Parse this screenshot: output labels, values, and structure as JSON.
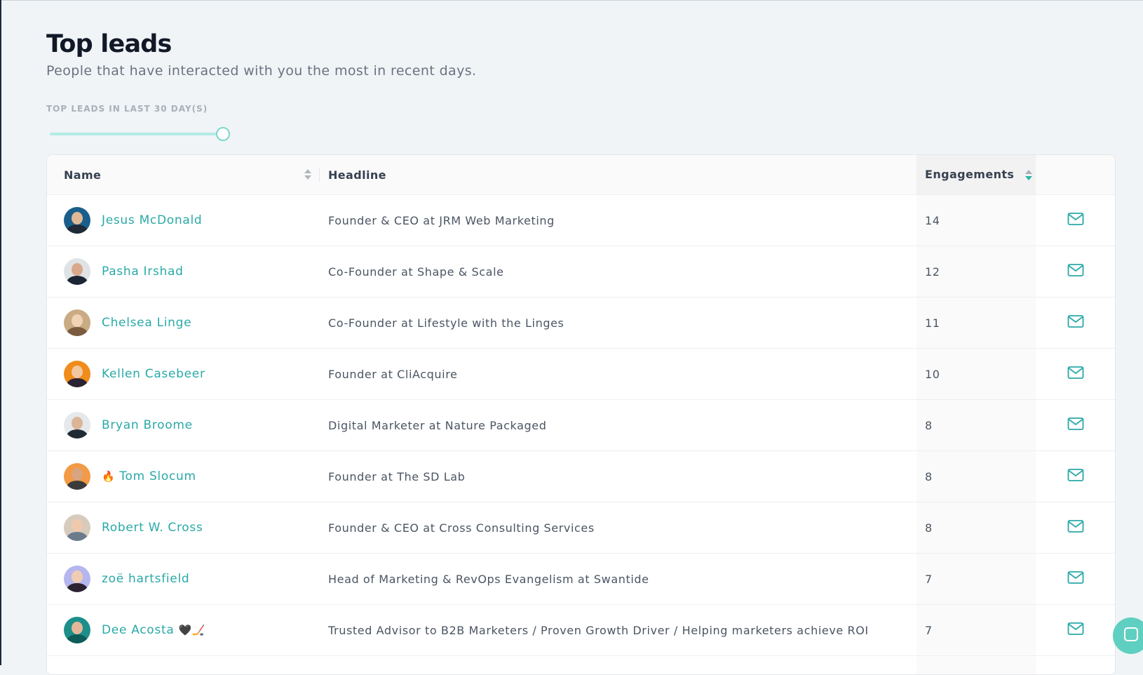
{
  "header": {
    "title": "Top leads",
    "subtitle": "People that have interacted with you the most in recent days."
  },
  "filter": {
    "label": "TOP LEADS IN LAST 30 DAY(S)",
    "slider_fraction": 1.0
  },
  "table": {
    "columns": {
      "name": "Name",
      "headline": "Headline",
      "engagements": "Engagements"
    },
    "rows": [
      {
        "prefix": "",
        "name": "Jesus McDonald",
        "suffix": "",
        "headline": "Founder & CEO at JRM Web Marketing",
        "engagements": "14",
        "avatar_bg": "#1a5f8c",
        "avatar_skin": "#e0b896",
        "avatar_shirt": "#1f2937"
      },
      {
        "prefix": "",
        "name": "Pasha Irshad",
        "suffix": "",
        "headline": "Co-Founder at Shape & Scale",
        "engagements": "12",
        "avatar_bg": "#dfe3e6",
        "avatar_skin": "#d9a98a",
        "avatar_shirt": "#1c2533"
      },
      {
        "prefix": "",
        "name": "Chelsea Linge",
        "suffix": "",
        "headline": "Co-Founder at Lifestyle with the Linges",
        "engagements": "11",
        "avatar_bg": "#c9ab84",
        "avatar_skin": "#f0d2b4",
        "avatar_shirt": "#7a5b3d"
      },
      {
        "prefix": "",
        "name": "Kellen Casebeer",
        "suffix": "",
        "headline": "Founder at CliAcquire",
        "engagements": "10",
        "avatar_bg": "#f08c1a",
        "avatar_skin": "#f3c7a0",
        "avatar_shirt": "#2b2233"
      },
      {
        "prefix": "",
        "name": "Bryan Broome",
        "suffix": "",
        "headline": "Digital Marketer at Nature Packaged",
        "engagements": "8",
        "avatar_bg": "#e5e9ec",
        "avatar_skin": "#dcb596",
        "avatar_shirt": "#202a33"
      },
      {
        "prefix": "🔥",
        "name": "Tom Slocum",
        "suffix": "",
        "headline": "Founder at The SD Lab",
        "engagements": "8",
        "avatar_bg": "#f29a45",
        "avatar_skin": "#d9a480",
        "avatar_shirt": "#3b3b3b"
      },
      {
        "prefix": "",
        "name": "Robert W. Cross",
        "suffix": "",
        "headline": "Founder & CEO at Cross Consulting Services",
        "engagements": "8",
        "avatar_bg": "#d7cbbd",
        "avatar_skin": "#f0c9ad",
        "avatar_shirt": "#6b7b8c"
      },
      {
        "prefix": "",
        "name": "zoë hartsfield",
        "suffix": "",
        "headline": "Head of Marketing & RevOps Evangelism at Swantide",
        "engagements": "7",
        "avatar_bg": "#b5b6ef",
        "avatar_skin": "#f0cdb2",
        "avatar_shirt": "#2a2230"
      },
      {
        "prefix": "",
        "name": "Dee Acosta",
        "suffix": "🖤🏒",
        "headline": "Trusted Advisor to B2B Marketers / Proven Growth Driver / Helping marketers achieve ROI",
        "engagements": "7",
        "avatar_bg": "#1d8f8a",
        "avatar_skin": "#e3b89a",
        "avatar_shirt": "#0d5c59"
      },
      {
        "prefix": "",
        "name": "",
        "suffix": "",
        "headline": "",
        "engagements": "",
        "avatar_bg": "#cccccc",
        "avatar_skin": "#cccccc",
        "avatar_shirt": "#cccccc"
      }
    ]
  },
  "colors": {
    "accent": "#2aa9a8",
    "slider_track": "#b2ece6",
    "chat_bubble": "#5fcfc1"
  },
  "icons": {
    "row_action": "mail-icon",
    "chat_widget": "chat-icon"
  }
}
